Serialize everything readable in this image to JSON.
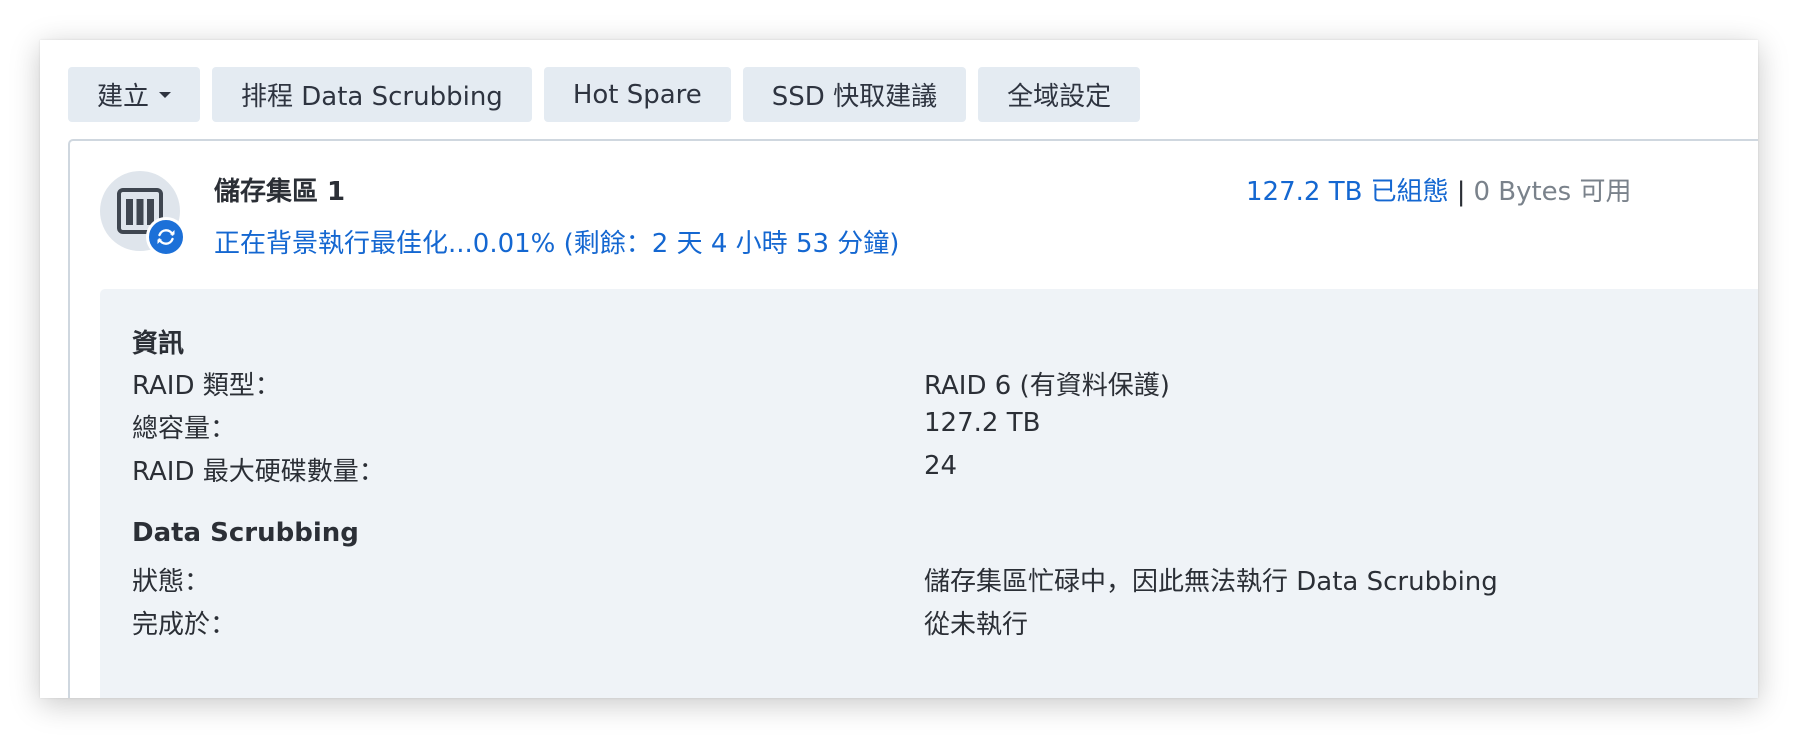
{
  "toolbar": {
    "create_label": "建立",
    "schedule_label": "排程 Data Scrubbing",
    "hot_spare_label": "Hot Spare",
    "ssd_cache_label": "SSD 快取建議",
    "global_settings_label": "全域設定"
  },
  "pool": {
    "title": "儲存集區 1",
    "progress_text": "正在背景執行最佳化...0.01% (剩餘：2 天 4 小時 53 分鐘)",
    "progress_percent": 0.01,
    "capacity_configured": "127.2 TB 已組態",
    "capacity_separator": "|",
    "capacity_available": "0 Bytes 可用",
    "icon": "storage-pool-icon",
    "badge_icon": "sync-icon",
    "accent_color": "#1467d1"
  },
  "info": {
    "section_title": "資訊",
    "rows": [
      {
        "label": "RAID 類型：",
        "value": "RAID 6 (有資料保護)"
      },
      {
        "label": "總容量：",
        "value": "127.2 TB"
      },
      {
        "label": "RAID 最大硬碟數量：",
        "value": "24"
      }
    ]
  },
  "scrubbing": {
    "section_title": "Data Scrubbing",
    "rows": [
      {
        "label": "狀態：",
        "value": "儲存集區忙碌中，因此無法執行 Data Scrubbing"
      },
      {
        "label": "完成於：",
        "value": "從未執行"
      }
    ]
  }
}
